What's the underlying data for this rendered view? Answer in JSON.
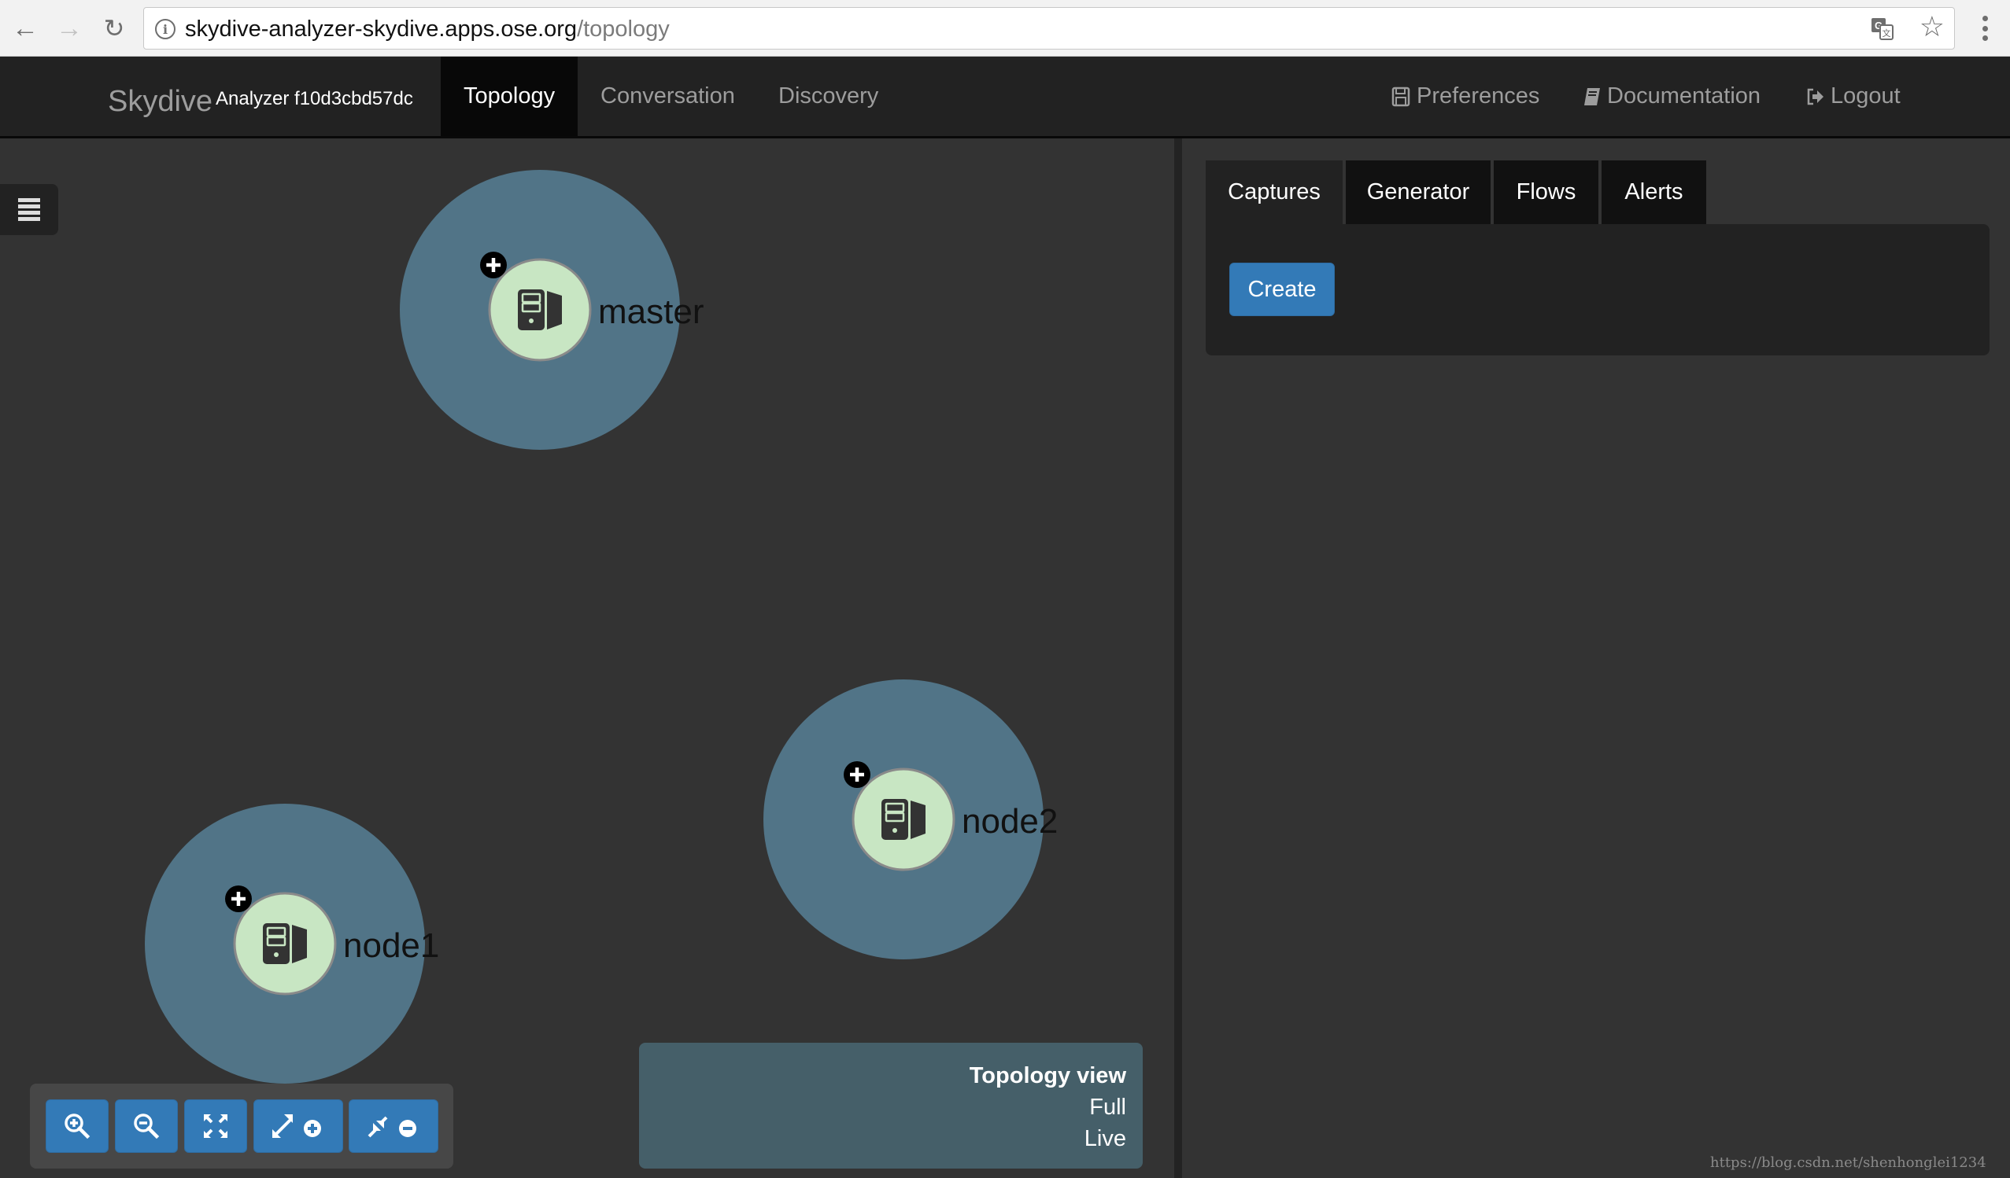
{
  "browser": {
    "url_host": "skydive-analyzer-skydive.apps.ose.org",
    "url_path": "/topology",
    "back_icon": "arrow-left-icon",
    "forward_icon": "arrow-right-icon",
    "reload_icon": "reload-icon",
    "site_info_icon": "info-icon",
    "translate_icon": "translate-icon",
    "bookmark_icon": "star-icon",
    "menu_icon": "vertical-dots-icon"
  },
  "navbar": {
    "brand": "Skydive",
    "brand_sub": "Analyzer f10d3cbd57dc",
    "items": [
      {
        "label": "Topology",
        "active": true
      },
      {
        "label": "Conversation",
        "active": false
      },
      {
        "label": "Discovery",
        "active": false
      }
    ],
    "right_items": [
      {
        "label": "Preferences",
        "icon": "floppy-disk-icon"
      },
      {
        "label": "Documentation",
        "icon": "book-icon"
      },
      {
        "label": "Logout",
        "icon": "sign-out-icon"
      }
    ]
  },
  "topology": {
    "menu_icon": "list-icon",
    "nodes": [
      {
        "label": "master",
        "icon": "server-icon",
        "expand_icon": "plus-circle-icon"
      },
      {
        "label": "node2",
        "icon": "server-icon",
        "expand_icon": "plus-circle-icon"
      },
      {
        "label": "node1",
        "icon": "server-icon",
        "expand_icon": "plus-circle-icon"
      }
    ],
    "colors": {
      "group_fill": "#517487",
      "node_fill": "#c8e6c3",
      "node_stroke": "#8a8a8a",
      "label": "#111111"
    },
    "zoom_controls": [
      {
        "name": "zoom-in",
        "icon": "zoom-in-icon"
      },
      {
        "name": "zoom-out",
        "icon": "zoom-out-icon"
      },
      {
        "name": "zoom-fit",
        "icon": "expand-arrows-icon"
      },
      {
        "name": "expand-all",
        "icon": "expand-plus-icon"
      },
      {
        "name": "collapse-all",
        "icon": "collapse-minus-icon"
      }
    ],
    "view_panel": {
      "title": "Topology view",
      "mode": "Full",
      "time": "Live"
    }
  },
  "right_panel": {
    "tabs": [
      {
        "label": "Captures",
        "active": true
      },
      {
        "label": "Generator",
        "active": false
      },
      {
        "label": "Flows",
        "active": false
      },
      {
        "label": "Alerts",
        "active": false
      }
    ],
    "create_label": "Create"
  },
  "watermark": "https://blog.csdn.net/shenhonglei1234",
  "colors": {
    "primary": "#337ab7",
    "navbar_bg": "#222222",
    "page_bg": "#333333"
  }
}
